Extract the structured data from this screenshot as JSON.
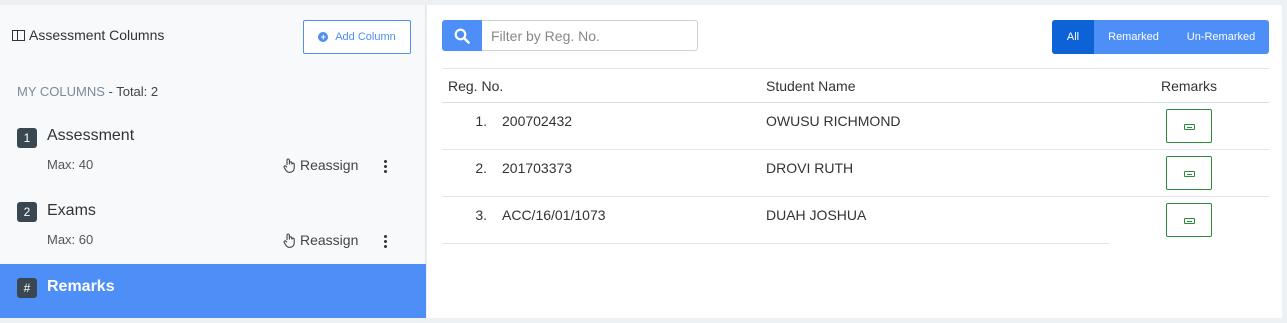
{
  "left": {
    "title": "Assessment Columns",
    "add_button": "Add Column",
    "my_columns_label": "MY COLUMNS",
    "total_text": " - Total: 2",
    "columns": [
      {
        "badge": "1",
        "name": "Assessment",
        "max": "Max: 40",
        "reassign": "Reassign"
      },
      {
        "badge": "2",
        "name": "Exams",
        "max": "Max: 60",
        "reassign": "Reassign"
      }
    ],
    "remarks": {
      "badge": "#",
      "name": "Remarks"
    }
  },
  "right": {
    "search_placeholder": "Filter by Reg. No.",
    "filters": [
      "All",
      "Remarked",
      "Un-Remarked"
    ],
    "active_filter": "All",
    "headers": {
      "reg": "Reg. No.",
      "name": "Student Name",
      "remarks": "Remarks"
    },
    "rows": [
      {
        "index": "1.",
        "reg": "200702432",
        "name": "OWUSU RICHMOND"
      },
      {
        "index": "2.",
        "reg": "201703373",
        "name": "DROVI RUTH"
      },
      {
        "index": "3.",
        "reg": "ACC/16/01/1073",
        "name": "DUAH JOSHUA"
      }
    ]
  },
  "colors": {
    "accent": "#4d8ef7",
    "active": "#0d62d6",
    "remark_border": "#2e8a3e",
    "badge": "#3a4750"
  }
}
